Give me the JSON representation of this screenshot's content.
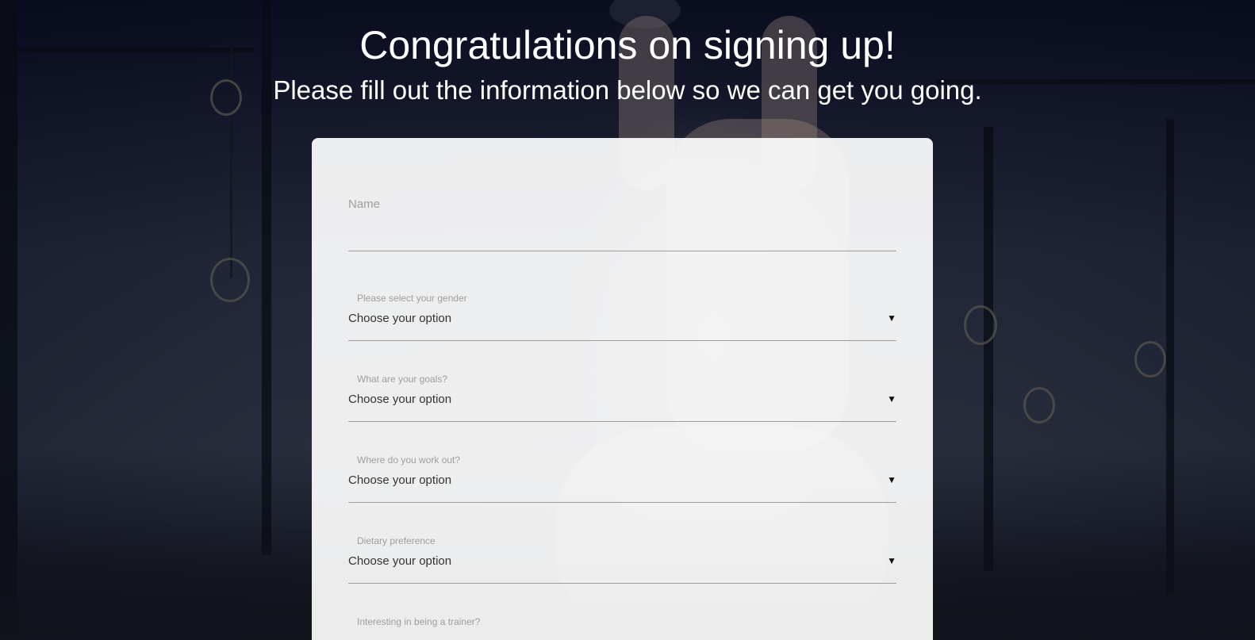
{
  "header": {
    "title": "Congratulations on signing up!",
    "subtitle": "Please fill out the information below so we can get you going."
  },
  "form": {
    "name_placeholder": "Name",
    "fields": [
      {
        "label": "Please select your gender",
        "value": "Choose your option"
      },
      {
        "label": "What are your goals?",
        "value": "Choose your option"
      },
      {
        "label": "Where do you work out?",
        "value": "Choose your option"
      },
      {
        "label": "Dietary preference",
        "value": "Choose your option"
      },
      {
        "label": "Interesting in being a trainer?",
        "value": ""
      }
    ],
    "caret_icon": "triangle-down-icon"
  },
  "colors": {
    "header_text": "#ffffff",
    "card_bg": "#f3f3f4",
    "label_gray": "#9e9e9e",
    "underline": "#9e9e9e"
  }
}
